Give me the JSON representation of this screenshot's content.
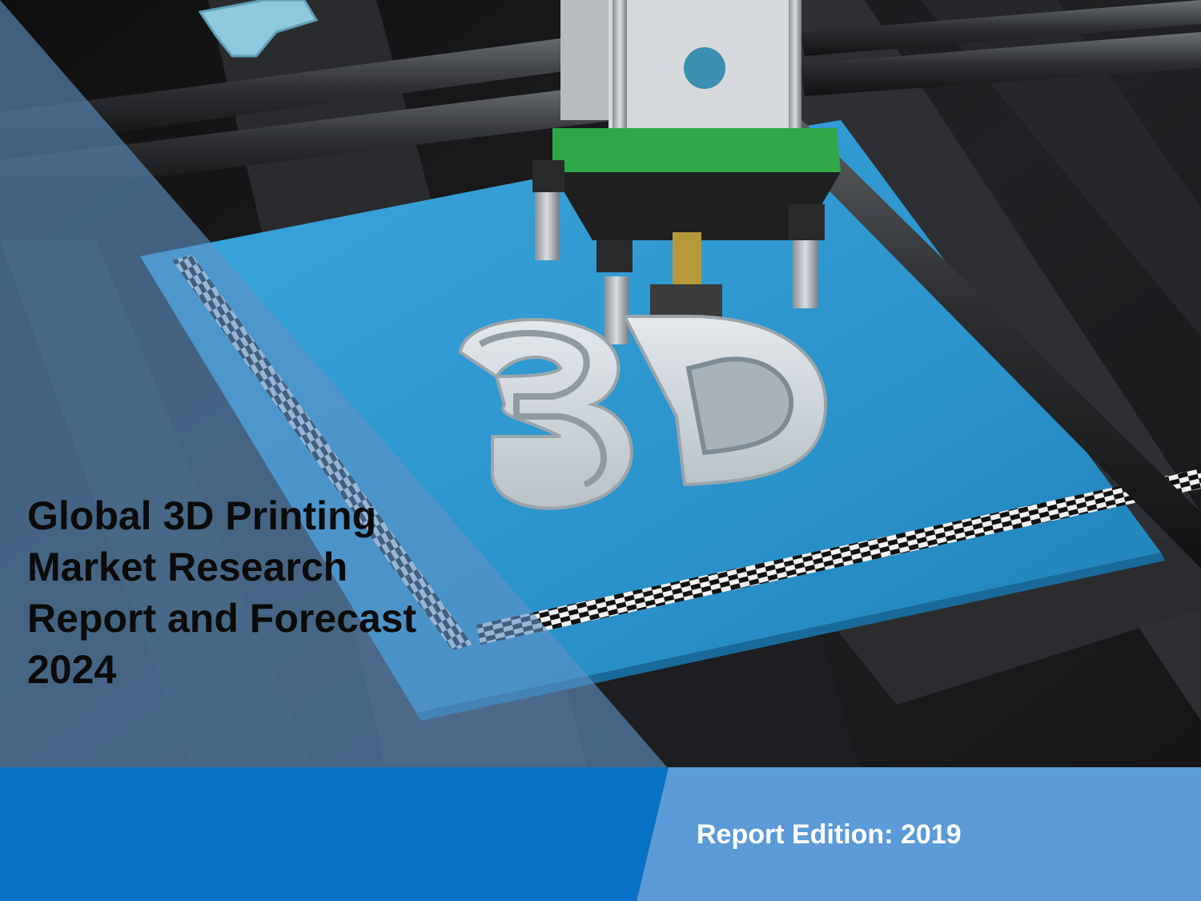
{
  "title": {
    "lines": [
      "Global 3D Printing",
      "Market Research",
      "Report and Forecast",
      "2024"
    ]
  },
  "footer": {
    "edition_label": "Report Edition: 2019"
  },
  "colors": {
    "overlay_blue": "#5f91c4",
    "bar_dark_blue": "#0872c6",
    "bar_light_blue": "#5c9bd8",
    "print_bed": "#2f9bd3",
    "title_text": "#0b0b0b",
    "edition_text": "#ffffff"
  },
  "image": {
    "subject": "3D printer extruder printing the letters 3D on a blue print bed",
    "printed_letters": "3D"
  }
}
